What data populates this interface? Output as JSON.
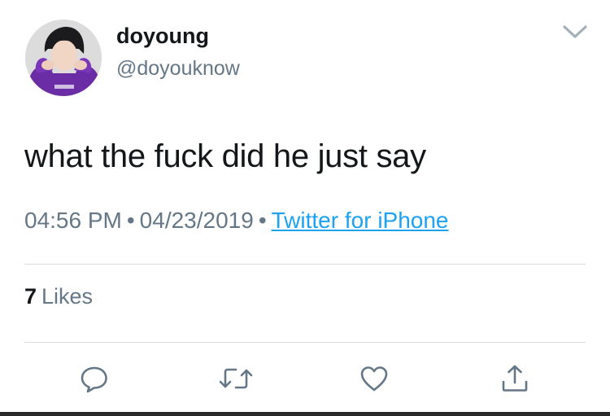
{
  "author": {
    "display_name": "doyoung",
    "handle": "@doyouknow",
    "avatar_icon": "profile-photo"
  },
  "tweet": {
    "text": "what the fuck did he just say",
    "time": "04:56 PM",
    "separator": "•",
    "date": "04/23/2019",
    "source": "Twitter for iPhone"
  },
  "stats": {
    "likes_count": "7",
    "likes_label": "Likes"
  },
  "actions": [
    {
      "icon": "reply-icon"
    },
    {
      "icon": "retweet-icon"
    },
    {
      "icon": "like-icon"
    },
    {
      "icon": "share-icon"
    }
  ],
  "colors": {
    "text": "#14171a",
    "secondary": "#657786",
    "link": "#1da1f2",
    "divider": "#d8dde1",
    "icon": "#657786"
  }
}
